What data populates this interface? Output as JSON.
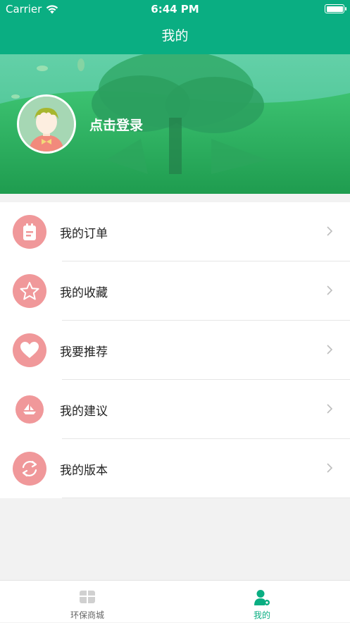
{
  "status_bar": {
    "carrier": "Carrier",
    "time": "6:44 PM"
  },
  "nav": {
    "title": "我的"
  },
  "profile": {
    "login_text": "点击登录"
  },
  "menu": {
    "items": [
      {
        "label": "我的订单",
        "icon": "order-icon"
      },
      {
        "label": "我的收藏",
        "icon": "star-icon"
      },
      {
        "label": "我要推荐",
        "icon": "heart-icon"
      },
      {
        "label": "我的建议",
        "icon": "boat-icon"
      },
      {
        "label": "我的版本",
        "icon": "refresh-icon"
      }
    ]
  },
  "tab_bar": {
    "tabs": [
      {
        "label": "环保商城",
        "active": false
      },
      {
        "label": "我的",
        "active": true
      }
    ]
  },
  "colors": {
    "primary": "#0aae82",
    "icon_bg": "#f0989a"
  }
}
